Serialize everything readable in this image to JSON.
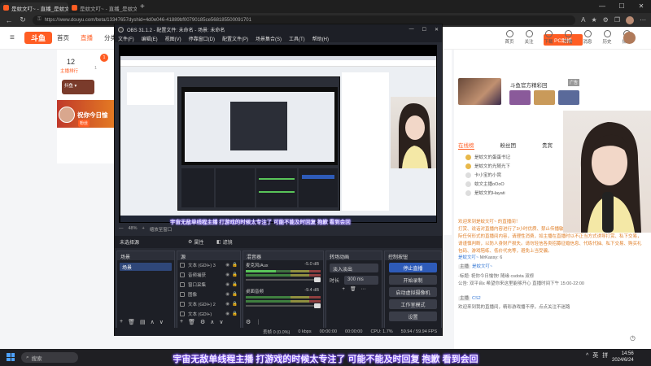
{
  "browser": {
    "tabs": [
      {
        "label": "是蚊文叮~ - 直播_是蚊文叮~ - 直播",
        "close": "×"
      },
      {
        "label": "是蚊文叮~ - 直播_是蚊文叮~ - 直播",
        "close": "×"
      }
    ],
    "new_tab": "+",
    "window_controls": [
      "—",
      "☐",
      "✕"
    ],
    "url": "https://www.douyu.com/beta/13347657dyshid=4d0e046-41889bf00790185ce568185500091701"
  },
  "douyu": {
    "logo": "斗鱼",
    "nav": [
      "首页",
      "直播",
      "分类"
    ],
    "right_icons": [
      "首页",
      "关注",
      "下载",
      "开播",
      "消息",
      "历史",
      "探索"
    ],
    "pc_button": "PC助播",
    "left_panel": {
      "count": "12",
      "count_label": "主播排行",
      "badge": "1",
      "sub": "1",
      "pill": "抖鱼 ▾",
      "wish": "祝你今日愉",
      "wish_badge": "粉丝"
    },
    "sidebar": {
      "title": "斗鱼官方精彩回",
      "tag": "广告",
      "tabs": [
        "在线榜",
        "粉丝团",
        "贵宾"
      ],
      "rank_rows": [
        "是蚊文的蛋蛋书记",
        "是蚊文的光随光下",
        "卡小宝的小窝",
        "蚊文主播oOoO",
        "是蚊文的Hayati"
      ],
      "chat": [
        {
          "text": "欢迎来到是蚊文叮~ 的直播间！",
          "orange": true
        },
        {
          "text": "打赏、说话对直播内容进行了3小时优质、禁止传播敏感信息、至明确惠、你出外感，帮加平播际任何形式的直播间内容，请理性消费，如主播在直播时以不正当方式诱导打赏、私下交易，请谨慎判断，以防人身财产损失。请勿轻信各类招募征婚信息、代练代抽、私下交易、购买礼包码、游戏陪练、低价代充等，避免上当受骗。",
          "orange": true
        },
        {
          "name": "是蚊文叮~",
          "text": "MrKassy: 6"
        },
        {
          "host": "主播",
          "name": "是蚊文叮~",
          "text": ""
        },
        {
          "text": "·标题: 祝你今日愉快! 随缘 csdota 双修"
        },
        {
          "text": "公告: 双平台ε 希望你来这里能够开心 直播时间下午 15:00-22:00"
        },
        {
          "host": "主播",
          "name": "CS2",
          "text": ""
        },
        {
          "text": "欢迎来到我的直播间，精彩游戏播不停，点点关注不迷路"
        }
      ]
    }
  },
  "obs": {
    "title": "OBS 31.1.2 - 配置文件: 未命名 - 场景: 未命名",
    "window_controls": [
      "—",
      "☐",
      "✕"
    ],
    "menu": [
      "文件(F)",
      "编辑(E)",
      "视图(V)",
      "停靠窗口(D)",
      "配置文件(P)",
      "场景集合(S)",
      "工具(T)",
      "帮助(H)"
    ],
    "preview_subtitle": "宇宙无敌单线程主播 打游戏的时候太专注了 可能不能及时回复 抱歉 看到会回",
    "zoom": "48%",
    "zoom_fit": "缩放至窗口",
    "source_bar": {
      "selected": "未选择源",
      "props": "属性",
      "filters": "滤镜"
    },
    "scenes": {
      "header": "场景",
      "items": [
        "场景"
      ]
    },
    "sources": {
      "header": "源",
      "items": [
        "文本 (GDI+) 3",
        "音频捕获",
        "窗口采集",
        "图像",
        "文本 (GDI+) 2",
        "文本 (GDI+)"
      ]
    },
    "mixer": {
      "header": "混音器",
      "channels": [
        {
          "name": "麦克风/Aux",
          "db": "-5.0 dB",
          "lit": true
        },
        {
          "name": "桌面音频",
          "db": "-9.4 dB",
          "lit": false
        }
      ]
    },
    "transitions": {
      "header": "转场动画",
      "type": "淡入淡出",
      "duration_label": "时长",
      "duration": "300 ms"
    },
    "controls": {
      "header": "控制按钮",
      "buttons": [
        "停止直播",
        "开始录制",
        "启动虚拟摄像机",
        "工作室模式",
        "设置"
      ]
    },
    "status": {
      "dropped": "丢帧 0 (0.0%)",
      "bitrate": "0 kbps",
      "time1": "00:00:00",
      "time2": "00:00:00",
      "cpu": "CPU: 1.7%",
      "fps": "59.94 / 59.94 FPS"
    }
  },
  "overlay_subtitle": "宇宙无敌单线程主播 打游戏的时候太专注了 可能不能及时回复 抱歉 看到会回",
  "taskbar": {
    "search": "搜索",
    "tray": [
      "^",
      "英",
      "拼"
    ],
    "time": "14:56",
    "date": "2024/6/24"
  }
}
